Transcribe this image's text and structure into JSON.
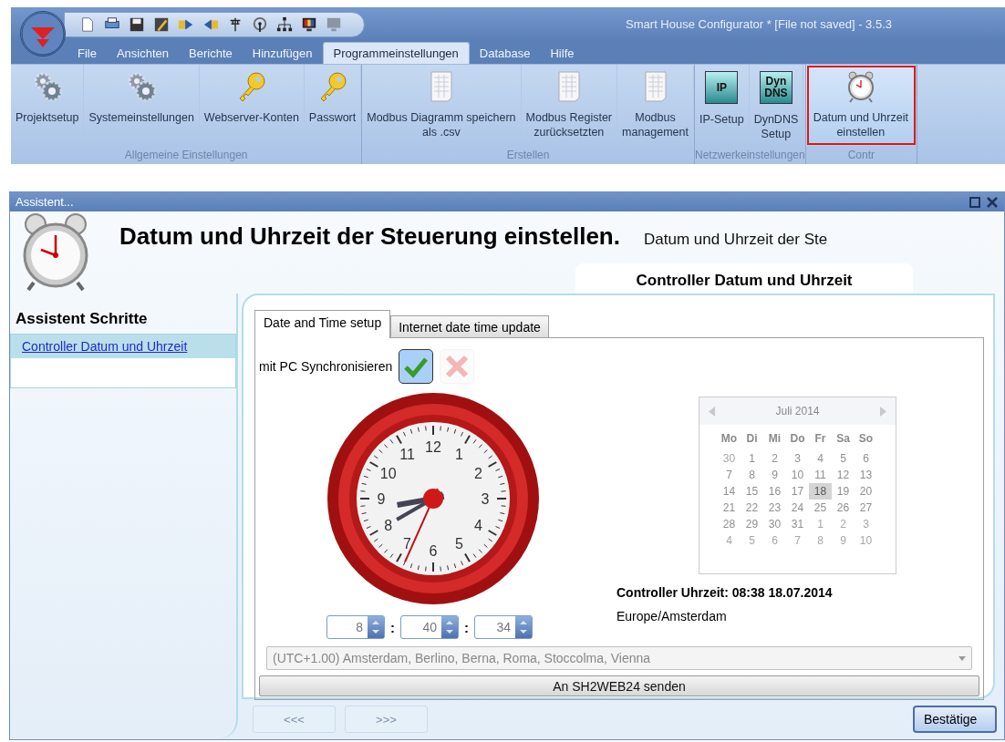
{
  "app": {
    "title": "Smart House Configurator * [File not saved] - 3.5.3",
    "tabs": [
      {
        "label": "File",
        "selected": false
      },
      {
        "label": "Ansichten",
        "selected": false
      },
      {
        "label": "Berichte",
        "selected": false
      },
      {
        "label": "Hinzufügen",
        "selected": false
      },
      {
        "label": "Programmeinstellungen",
        "selected": true
      },
      {
        "label": "Database",
        "selected": false
      },
      {
        "label": "Hilfe",
        "selected": false
      }
    ],
    "ribbon_groups": [
      {
        "label": "Allgemeine Einstellungen",
        "buttons": [
          {
            "kind": "gears",
            "label": "Projektsetup",
            "highlighted": false
          },
          {
            "kind": "gears",
            "label": "Systemeinstellungen",
            "highlighted": false
          },
          {
            "kind": "key",
            "label": "Webserver-Konten",
            "highlighted": false
          },
          {
            "kind": "key",
            "label": "Passwort",
            "highlighted": false
          }
        ]
      },
      {
        "label": "Erstellen",
        "buttons": [
          {
            "kind": "sheet",
            "label": "Modbus Diagramm speichern\nals .csv",
            "highlighted": false
          },
          {
            "kind": "sheet",
            "label": "Modbus Register\nzurücksetzten",
            "highlighted": false
          },
          {
            "kind": "sheet",
            "label": "Modbus\nmanagement",
            "highlighted": false
          }
        ]
      },
      {
        "label": "Netzwerkeinstellungen",
        "buttons": [
          {
            "kind": "tile",
            "icon_text": "IP",
            "label": "IP-Setup",
            "highlighted": false
          },
          {
            "kind": "tile",
            "icon_text": "Dyn\nDNS",
            "label": "DynDNS\nSetup",
            "highlighted": false
          }
        ]
      },
      {
        "label": "Contr",
        "buttons": [
          {
            "kind": "clock",
            "label": "Datum und Uhrzeit\neinstellen",
            "highlighted": true
          }
        ]
      }
    ]
  },
  "dialog": {
    "title": "Assistent...",
    "heading": "Datum und Uhrzeit der Steuerung einstellen.",
    "subheading": "Datum und Uhrzeit der Ste",
    "page_tab": "Controller Datum und Uhrzeit",
    "steps_title": "Assistent Schritte",
    "steps": [
      {
        "label": "Controller Datum und Uhrzeit",
        "selected": true
      }
    ],
    "tabs": [
      {
        "label": "Date and Time setup",
        "selected": true
      },
      {
        "label": "Internet date time update",
        "selected": false
      }
    ],
    "sync_label": "mit PC Synchronisieren",
    "sync_buttons": [
      {
        "kind": "check",
        "selected": true,
        "disabled": false
      },
      {
        "kind": "cross",
        "selected": false,
        "disabled": true
      }
    ],
    "clock": {
      "numerals": [
        "12",
        "1",
        "2",
        "3",
        "4",
        "5",
        "6",
        "7",
        "8",
        "9",
        "10",
        "11"
      ]
    },
    "time_fields": [
      {
        "value": "8"
      },
      {
        "value": "40"
      },
      {
        "value": "34"
      }
    ],
    "separators": [
      ":",
      ":"
    ],
    "calendar": {
      "month": "Juli 2014",
      "disabled": true,
      "weekdays": [
        "Mo",
        "Di",
        "Mi",
        "Do",
        "Fr",
        "Sa",
        "So"
      ],
      "days": [
        {
          "day": "30",
          "other_month": true,
          "selected": false
        },
        {
          "day": "1",
          "other_month": false,
          "selected": false
        },
        {
          "day": "2",
          "other_month": false,
          "selected": false
        },
        {
          "day": "3",
          "other_month": false,
          "selected": false
        },
        {
          "day": "4",
          "other_month": false,
          "selected": false
        },
        {
          "day": "5",
          "other_month": false,
          "selected": false
        },
        {
          "day": "6",
          "other_month": false,
          "selected": false
        },
        {
          "day": "7",
          "other_month": false,
          "selected": false
        },
        {
          "day": "8",
          "other_month": false,
          "selected": false
        },
        {
          "day": "9",
          "other_month": false,
          "selected": false
        },
        {
          "day": "10",
          "other_month": false,
          "selected": false
        },
        {
          "day": "11",
          "other_month": false,
          "selected": false
        },
        {
          "day": "12",
          "other_month": false,
          "selected": false
        },
        {
          "day": "13",
          "other_month": false,
          "selected": false
        },
        {
          "day": "14",
          "other_month": false,
          "selected": false
        },
        {
          "day": "15",
          "other_month": false,
          "selected": false
        },
        {
          "day": "16",
          "other_month": false,
          "selected": false
        },
        {
          "day": "17",
          "other_month": false,
          "selected": false
        },
        {
          "day": "18",
          "other_month": false,
          "selected": true
        },
        {
          "day": "19",
          "other_month": false,
          "selected": false
        },
        {
          "day": "20",
          "other_month": false,
          "selected": false
        },
        {
          "day": "21",
          "other_month": false,
          "selected": false
        },
        {
          "day": "22",
          "other_month": false,
          "selected": false
        },
        {
          "day": "23",
          "other_month": false,
          "selected": false
        },
        {
          "day": "24",
          "other_month": false,
          "selected": false
        },
        {
          "day": "25",
          "other_month": false,
          "selected": false
        },
        {
          "day": "26",
          "other_month": false,
          "selected": false
        },
        {
          "day": "27",
          "other_month": false,
          "selected": false
        },
        {
          "day": "28",
          "other_month": false,
          "selected": false
        },
        {
          "day": "29",
          "other_month": false,
          "selected": false
        },
        {
          "day": "30",
          "other_month": false,
          "selected": false
        },
        {
          "day": "31",
          "other_month": false,
          "selected": false
        },
        {
          "day": "1",
          "other_month": true,
          "selected": false
        },
        {
          "day": "2",
          "other_month": true,
          "selected": false
        },
        {
          "day": "3",
          "other_month": true,
          "selected": false
        },
        {
          "day": "4",
          "other_month": true,
          "selected": false
        },
        {
          "day": "5",
          "other_month": true,
          "selected": false
        },
        {
          "day": "6",
          "other_month": true,
          "selected": false
        },
        {
          "day": "7",
          "other_month": true,
          "selected": false
        },
        {
          "day": "8",
          "other_month": true,
          "selected": false
        },
        {
          "day": "9",
          "other_month": true,
          "selected": false
        },
        {
          "day": "10",
          "other_month": true,
          "selected": false
        }
      ]
    },
    "controller_time": "Controller Uhrzeit: 08:38  18.07.2014",
    "timezone_name": "Europe/Amsterdam",
    "timezone_select": {
      "value": "(UTC+1.00) Amsterdam, Berlino, Berna, Roma, Stoccolma, Vienna",
      "disabled": true
    },
    "send_button": "An SH2WEB24 senden",
    "nav_buttons": [
      {
        "label": "<<<",
        "disabled": true
      },
      {
        "label": ">>>",
        "disabled": true
      }
    ],
    "confirm_button": "Bestätige"
  }
}
